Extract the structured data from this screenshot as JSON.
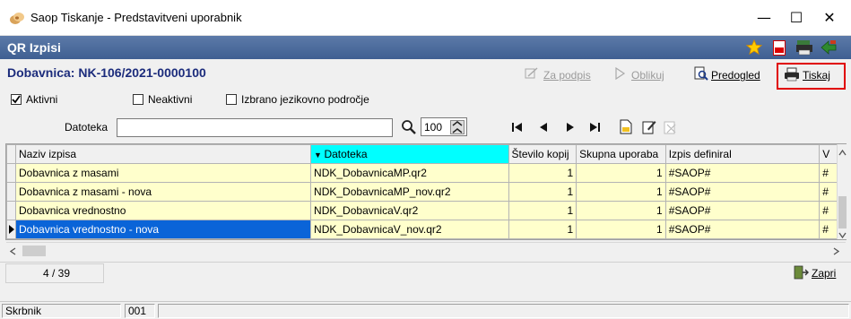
{
  "window": {
    "title": "Saop Tiskanje - Predstavitveni uporabnik",
    "minimize_glyph": "—",
    "maximize_glyph": "☐",
    "close_glyph": "✕"
  },
  "header": {
    "title": "QR Izpisi",
    "icons": [
      "star-icon",
      "pdf-icon",
      "printer-stack-icon",
      "exit-icon"
    ]
  },
  "document": {
    "title": "Dobavnica: NK-106/2021-0000100"
  },
  "toolbar": {
    "za_podpis": "Za podpis",
    "oblikuj": "Oblikuj",
    "predogled": "Predogled",
    "tiskaj": "Tiskaj"
  },
  "filters": {
    "aktivni": {
      "label": "Aktivni",
      "checked": true
    },
    "neaktivni": {
      "label": "Neaktivni",
      "checked": false
    },
    "jezik": {
      "label": "Izbrano jezikovno področje",
      "checked": false
    }
  },
  "search": {
    "label": "Datoteka",
    "value": "",
    "zoom": "100"
  },
  "table": {
    "columns": [
      "Naziv izpisa",
      "Datoteka",
      "Število kopij",
      "Skupna uporaba",
      "Izpis definiral",
      "V"
    ],
    "sorted_column": "Datoteka",
    "rows": [
      {
        "name": "Dobavnica z masami",
        "file": "NDK_DobavnicaMP.qr2",
        "copies": "1",
        "shared": "1",
        "author": "#SAOP#",
        "v": "#"
      },
      {
        "name": "Dobavnica z masami - nova",
        "file": "NDK_DobavnicaMP_nov.qr2",
        "copies": "1",
        "shared": "1",
        "author": "#SAOP#",
        "v": "#"
      },
      {
        "name": "Dobavnica vrednostno",
        "file": "NDK_DobavnicaV.qr2",
        "copies": "1",
        "shared": "1",
        "author": "#SAOP#",
        "v": "#"
      },
      {
        "name": "Dobavnica vrednostno - nova",
        "file": "NDK_DobavnicaV_nov.qr2",
        "copies": "1",
        "shared": "1",
        "author": "#SAOP#",
        "v": "#"
      }
    ]
  },
  "footer": {
    "counter": "4 / 39",
    "zapri": "Zapri"
  },
  "status": {
    "user": "Skrbnik",
    "code": "001"
  },
  "colors": {
    "header_band": "#4a6a9c",
    "doc_title": "#1c2c7c",
    "row_bg": "#ffffcc",
    "selected": "#0a64d8",
    "sorted_header": "#00ffff",
    "highlight_border": "#e00000"
  }
}
